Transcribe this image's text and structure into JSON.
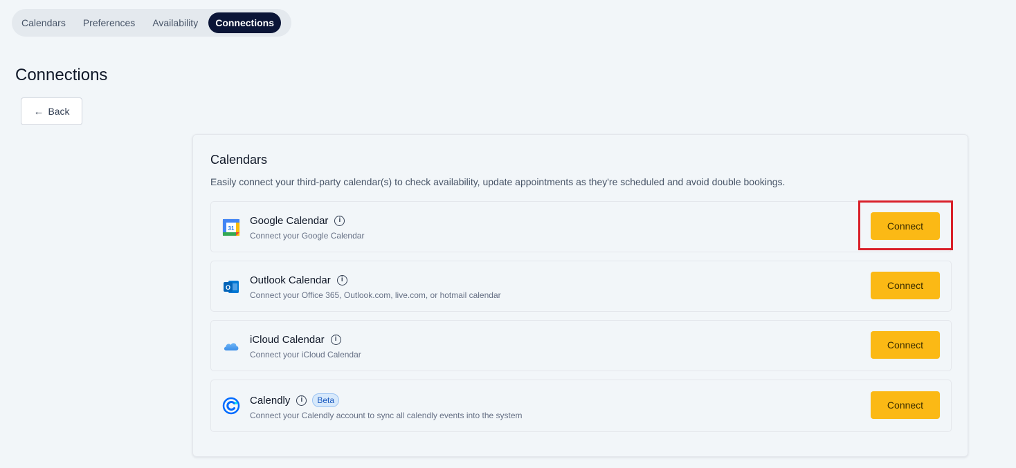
{
  "tabs": [
    {
      "label": "Calendars"
    },
    {
      "label": "Preferences"
    },
    {
      "label": "Availability"
    },
    {
      "label": "Connections"
    }
  ],
  "page": {
    "title": "Connections",
    "back_label": "Back"
  },
  "card": {
    "title": "Calendars",
    "description": "Easily connect your third-party calendar(s) to check availability, update appointments as they're scheduled and avoid double bookings.",
    "rows": [
      {
        "name": "Google Calendar",
        "subtitle": "Connect your Google Calendar",
        "button": "Connect",
        "icon": "google-calendar-icon",
        "logo_text": "31"
      },
      {
        "name": "Outlook Calendar",
        "subtitle": "Connect your Office 365, Outlook.com, live.com, or hotmail calendar",
        "button": "Connect",
        "icon": "outlook-icon",
        "logo_text": "O"
      },
      {
        "name": "iCloud Calendar",
        "subtitle": "Connect your iCloud Calendar",
        "button": "Connect",
        "icon": "icloud-icon"
      },
      {
        "name": "Calendly",
        "subtitle": "Connect your Calendly account to sync all calendly events into the system",
        "button": "Connect",
        "icon": "calendly-icon",
        "badge": "Beta"
      }
    ]
  },
  "info_glyph": "i",
  "colors": {
    "active_tab": "#0b1537",
    "connect_button": "#fbb915",
    "highlight_box": "#d9202a",
    "beta_badge": "#d7e9fb"
  }
}
